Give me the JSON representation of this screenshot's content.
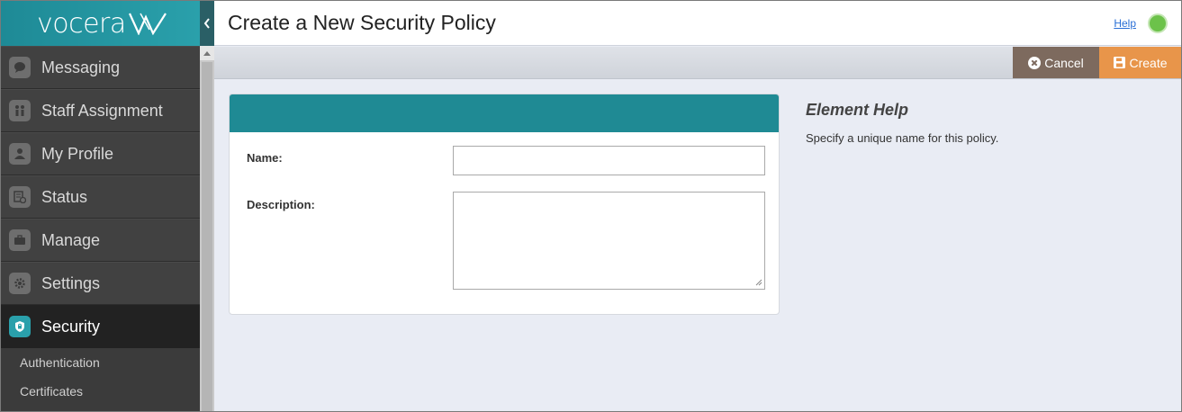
{
  "brand": {
    "logo_text": "vocera"
  },
  "sidebar": {
    "items": [
      {
        "label": "Messaging",
        "icon": "chat-bubble-icon"
      },
      {
        "label": "Staff Assignment",
        "icon": "people-icon"
      },
      {
        "label": "My Profile",
        "icon": "person-icon"
      },
      {
        "label": "Status",
        "icon": "status-icon"
      },
      {
        "label": "Manage",
        "icon": "briefcase-icon"
      },
      {
        "label": "Settings",
        "icon": "gear-icon"
      },
      {
        "label": "Security",
        "icon": "shield-icon",
        "active": true
      }
    ],
    "subitems": [
      {
        "label": "Authentication"
      },
      {
        "label": "Certificates"
      }
    ]
  },
  "header": {
    "title": "Create a New Security Policy",
    "help_label": "Help",
    "status_color": "#6cc24a"
  },
  "toolbar": {
    "cancel_label": "Cancel",
    "create_label": "Create"
  },
  "form": {
    "name_label": "Name:",
    "name_value": "",
    "description_label": "Description:",
    "description_value": ""
  },
  "help": {
    "title": "Element Help",
    "text": "Specify a unique name for this policy."
  },
  "colors": {
    "accent": "#1f8a94",
    "cancel": "#7d6a5e",
    "create": "#e8954a"
  }
}
